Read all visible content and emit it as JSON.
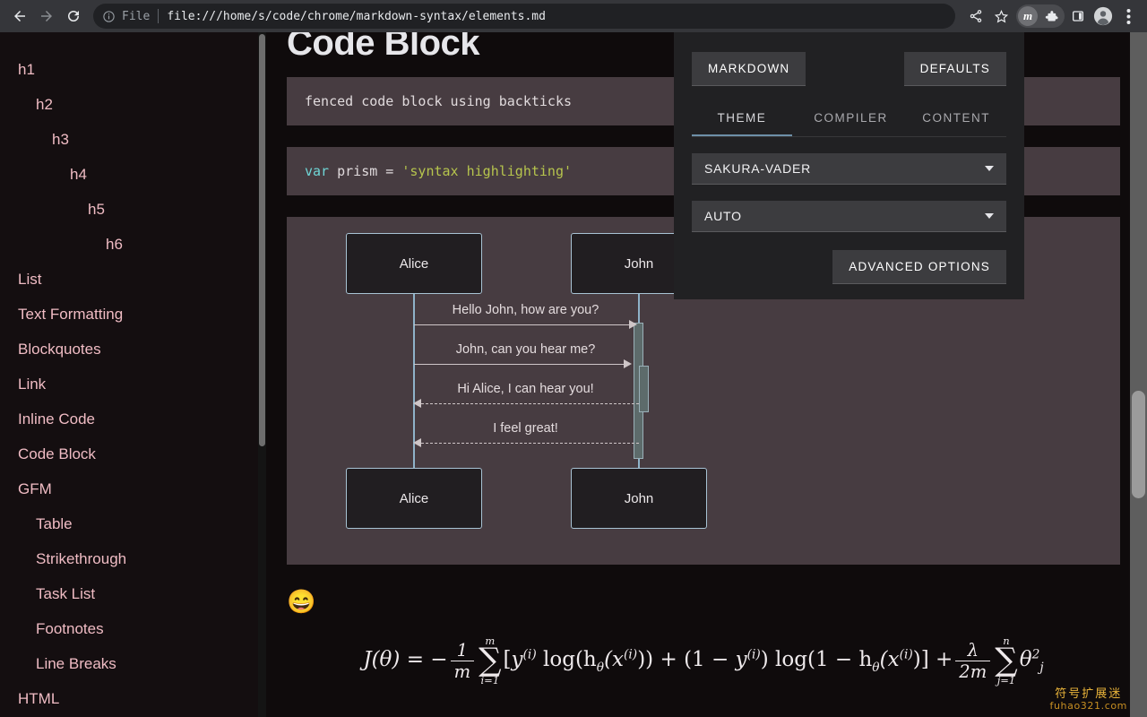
{
  "browser": {
    "back_label": "Back",
    "forward_label": "Forward",
    "reload_label": "Reload",
    "omnibox": {
      "info_icon": "info-circle-icon",
      "scheme_label": "File",
      "url": "file:///home/s/code/chrome/markdown-syntax/elements.md"
    },
    "toolbar_icons": [
      {
        "name": "share-icon",
        "label": "Share"
      },
      {
        "name": "bookmark-star-icon",
        "label": "Bookmark this tab"
      },
      {
        "name": "markdown-extension-icon",
        "label": "m"
      },
      {
        "name": "puzzle-piece-icon",
        "label": "Extensions"
      },
      {
        "name": "side-panel-icon",
        "label": "Side panel"
      },
      {
        "name": "profile-avatar-icon",
        "label": "Profile"
      },
      {
        "name": "kebab-menu-icon",
        "label": "Customize and control"
      }
    ]
  },
  "sidebar": {
    "items": [
      {
        "label": "h1",
        "indent": 0
      },
      {
        "label": "h2",
        "indent": 1
      },
      {
        "label": "h3",
        "indent": 2
      },
      {
        "label": "h4",
        "indent": 3
      },
      {
        "label": "h5",
        "indent": 4
      },
      {
        "label": "h6",
        "indent": 5
      },
      {
        "label": "List",
        "indent": 0
      },
      {
        "label": "Text Formatting",
        "indent": 0
      },
      {
        "label": "Blockquotes",
        "indent": 0
      },
      {
        "label": "Link",
        "indent": 0
      },
      {
        "label": "Inline Code",
        "indent": 0
      },
      {
        "label": "Code Block",
        "indent": 0
      },
      {
        "label": "GFM",
        "indent": 0
      },
      {
        "label": "Table",
        "indent": 1
      },
      {
        "label": "Strikethrough",
        "indent": 1
      },
      {
        "label": "Task List",
        "indent": 1
      },
      {
        "label": "Footnotes",
        "indent": 1
      },
      {
        "label": "Line Breaks",
        "indent": 1
      },
      {
        "label": "HTML",
        "indent": 0
      }
    ]
  },
  "content": {
    "heading": "Code Block",
    "code_blocks": [
      {
        "plain": "fenced code block using backticks"
      },
      {
        "tokens": [
          {
            "text": "var",
            "type": "keyword"
          },
          {
            "text": " prism = ",
            "type": "plain"
          },
          {
            "text": "'syntax highlighting'",
            "type": "string"
          }
        ]
      }
    ],
    "emoji": "😄",
    "math_formula": "J(θ) = - (1/m) ∑_{i=1}^{m} [ y^{(i)} log(h_θ(x^{(i)})) + (1 - y^{(i)}) log(1 - h_θ(x^{(i)})) ] + (λ/2m) ∑_{j=1}^{n} θ_j^2",
    "math_parts": {
      "lhs": "J(θ)",
      "eq": "=",
      "minus": "−",
      "frac1_num": "1",
      "frac1_den": "m",
      "sum1_upper": "m",
      "sum1_lower": "i=1",
      "bracket_open": "[",
      "term_y": "y",
      "sup_i": "(i)",
      "log1": "log(h",
      "theta": "θ",
      "xopen": "(x",
      "close1": "))",
      "plus": "+",
      "one_minus": "(1 − ",
      "log2": "log(1 − h",
      "bracket_close": ")]",
      "frac2_num": "λ",
      "frac2_den": "2m",
      "sum2_upper": "n",
      "sum2_lower": "j=1",
      "theta_j": "θ",
      "sub_j": "j",
      "sup_2": "2"
    },
    "diagram": {
      "type": "sequence-diagram",
      "actors_top": [
        "Alice",
        "John"
      ],
      "actors_bottom": [
        "Alice",
        "John"
      ],
      "messages": [
        {
          "label": "Hello John, how are you?",
          "direction": "right",
          "style": "solid"
        },
        {
          "label": "John, can you hear me?",
          "direction": "right",
          "style": "solid"
        },
        {
          "label": "Hi Alice, I can hear you!",
          "direction": "left",
          "style": "dashed"
        },
        {
          "label": "I feel great!",
          "direction": "left",
          "style": "dashed"
        }
      ]
    }
  },
  "settings_panel": {
    "markdown_button": "MARKDOWN",
    "defaults_button": "DEFAULTS",
    "tabs": [
      {
        "label": "THEME",
        "active": true
      },
      {
        "label": "COMPILER",
        "active": false
      },
      {
        "label": "CONTENT",
        "active": false
      }
    ],
    "theme_select": {
      "value": "SAKURA-VADER"
    },
    "mode_select": {
      "value": "AUTO"
    },
    "advanced_button": "ADVANCED OPTIONS",
    "accent_color": "#6d8fa8"
  },
  "watermark": {
    "cn_text": "符号扩展迷",
    "url_text": "fuhao321.com"
  }
}
